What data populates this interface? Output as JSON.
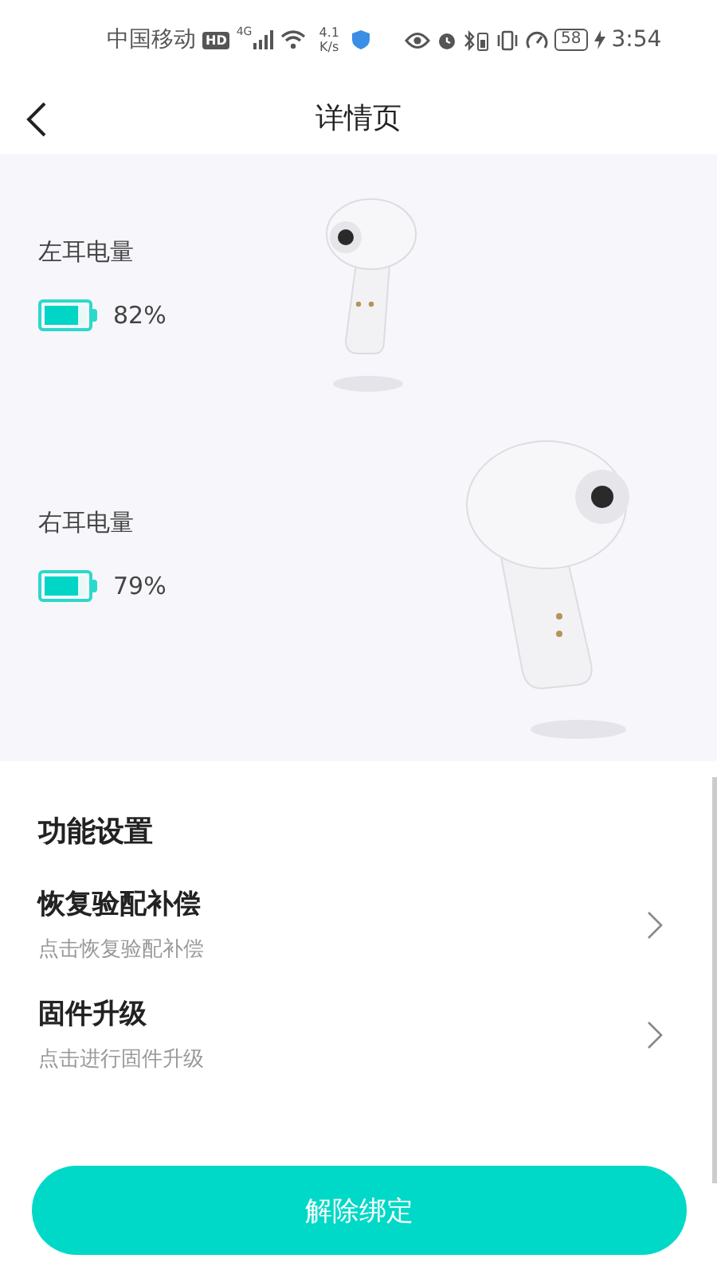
{
  "status_bar": {
    "carrier": "中国移动",
    "hd": "HD",
    "network": "4G",
    "speed": "4.1",
    "speed_unit": "K/s",
    "battery": "58",
    "time": "3:54"
  },
  "header": {
    "title": "详情页"
  },
  "earbuds": [
    {
      "label": "左耳电量",
      "level": 0.82,
      "reading": "82%"
    },
    {
      "label": "右耳电量",
      "level": 0.79,
      "reading": "79%"
    }
  ],
  "settings": {
    "title": "功能设置",
    "items": [
      {
        "title": "恢复验配补偿",
        "subtitle": "点击恢复验配补偿"
      },
      {
        "title": "固件升级",
        "subtitle": "点击进行固件升级"
      }
    ]
  },
  "unbind_button": "解除绑定"
}
